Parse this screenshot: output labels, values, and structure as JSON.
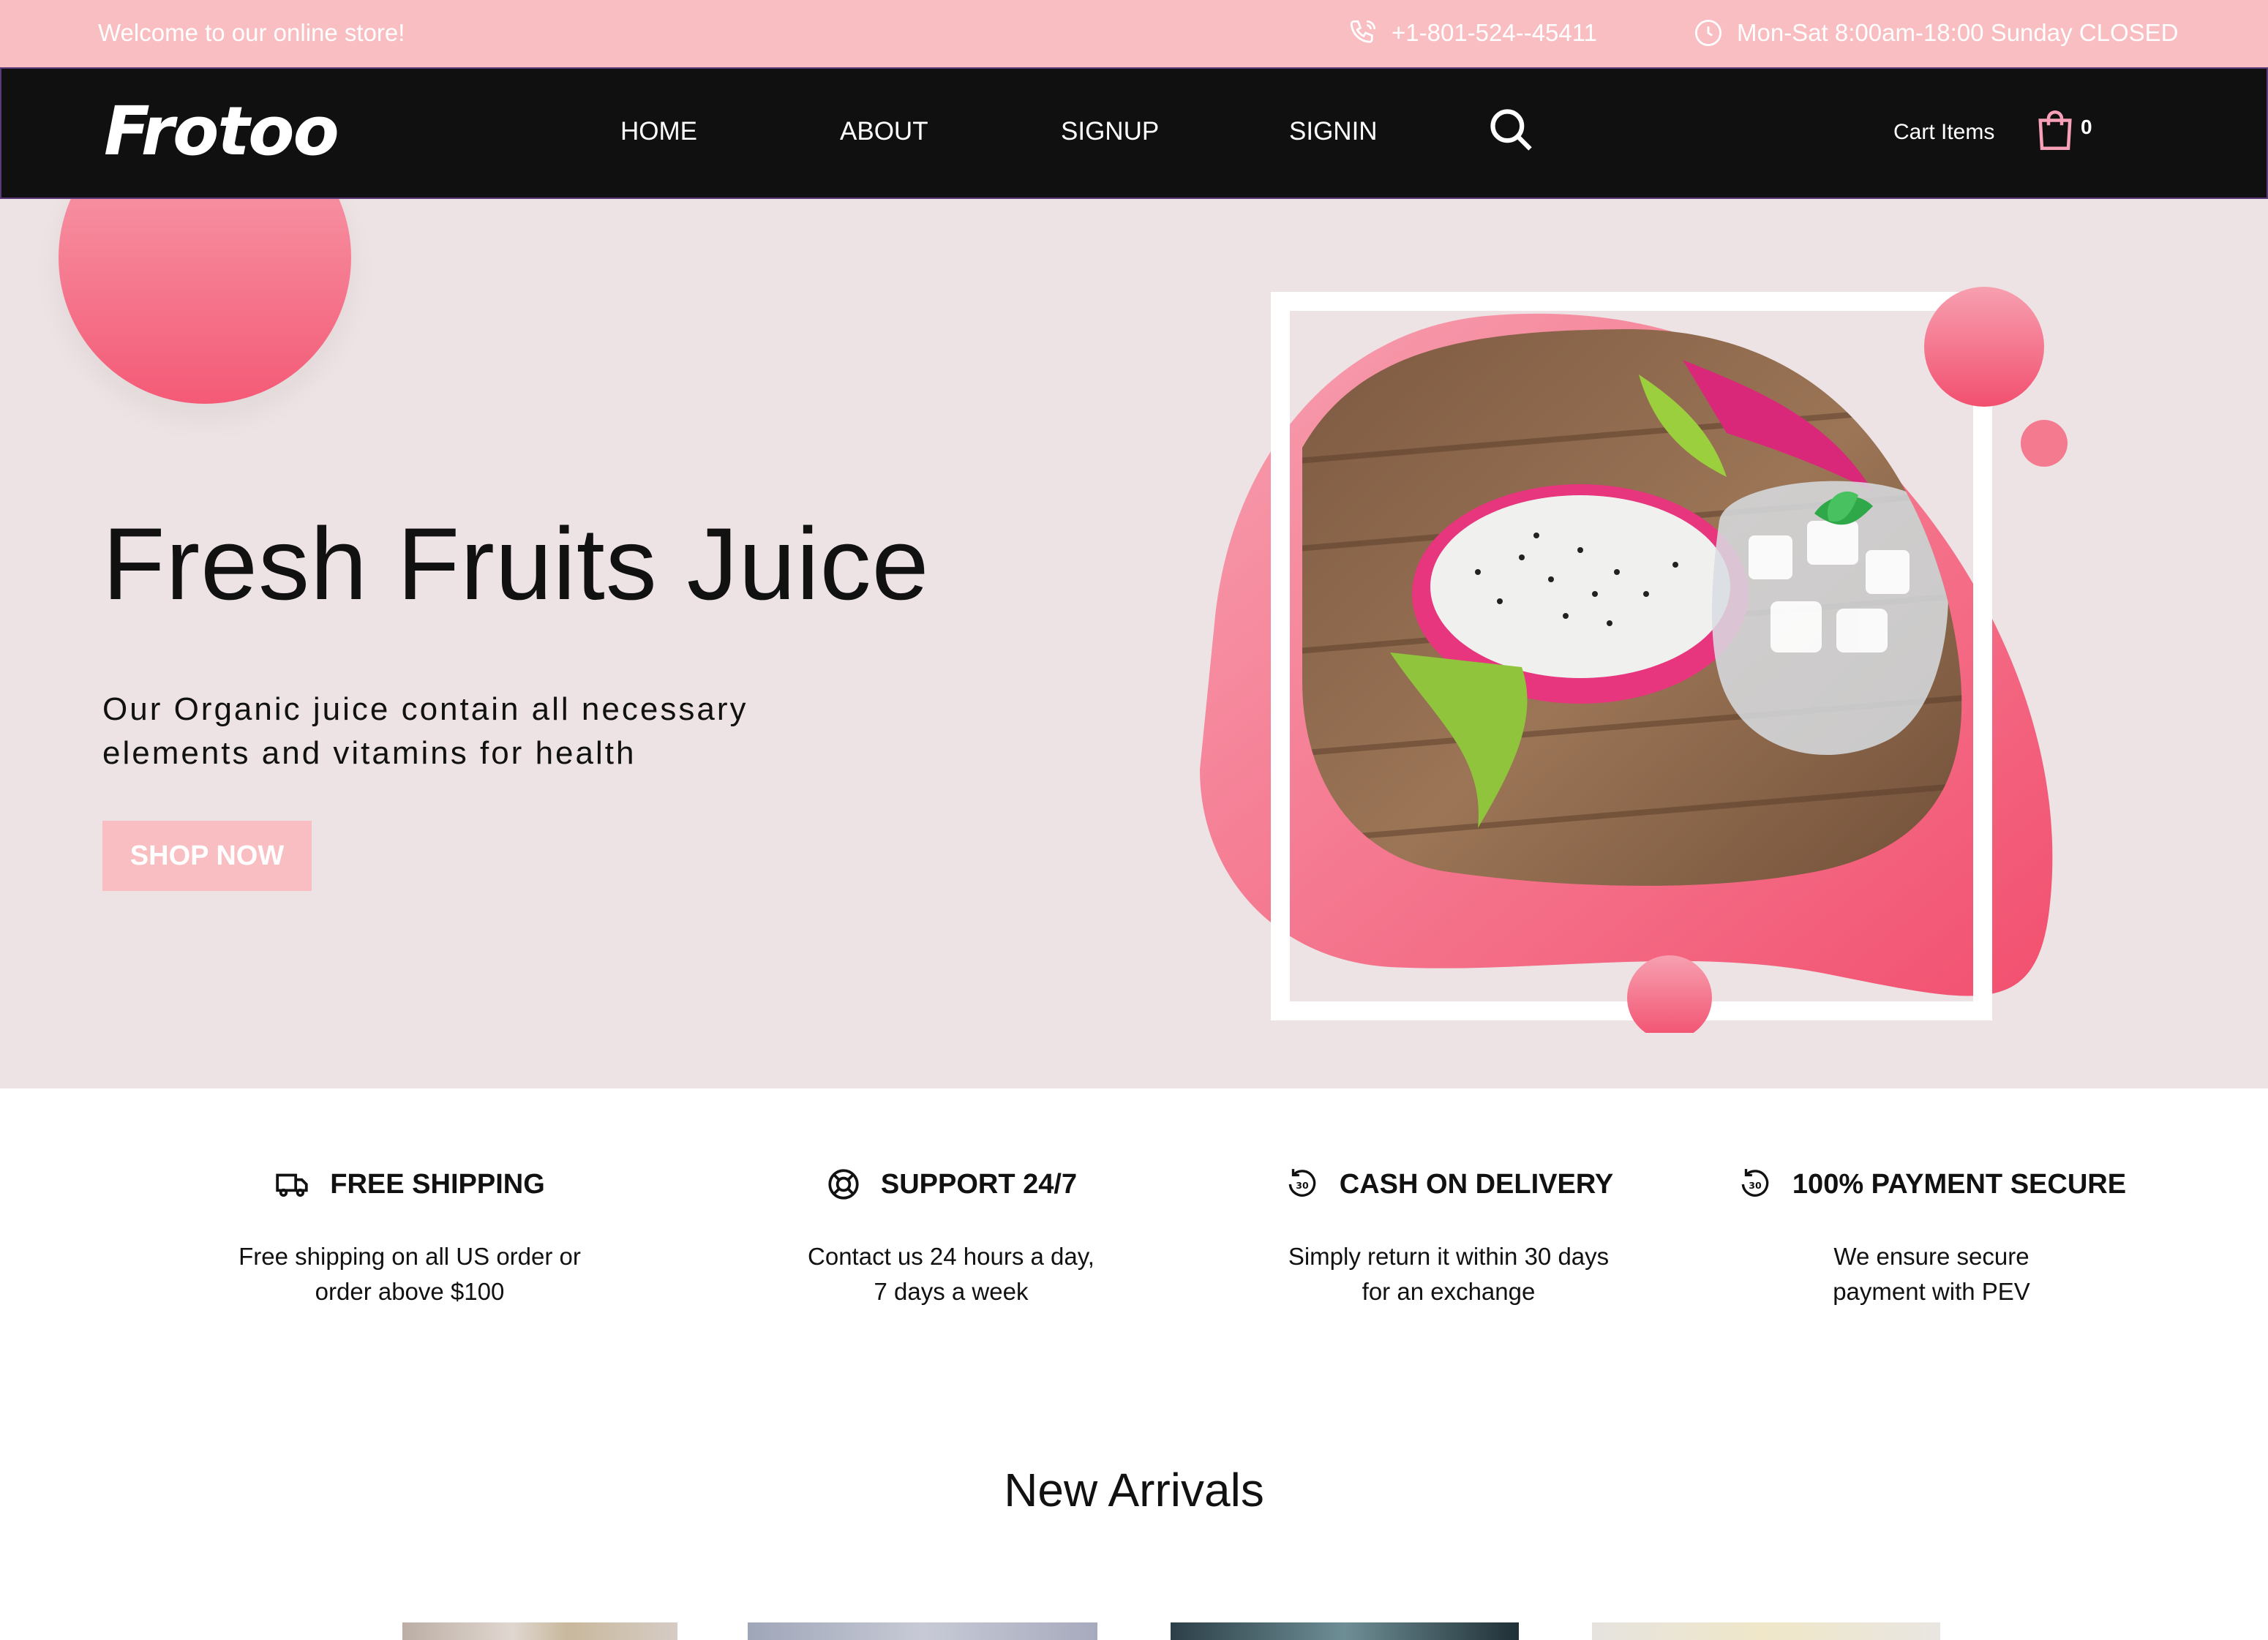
{
  "topbar": {
    "welcome": "Welcome to our online store!",
    "phone": "+1-801-524--45411",
    "hours": "Mon-Sat 8:00am-18:00 Sunday CLOSED",
    "phone_icon": "phone-icon",
    "clock_icon": "clock-icon"
  },
  "nav": {
    "logo": "Frotoo",
    "links": [
      "HOME",
      "ABOUT",
      "SIGNUP",
      "SIGNIN"
    ],
    "search_icon": "search-icon",
    "cart_label": "Cart Items",
    "cart_icon": "shopping-bag-icon",
    "cart_count": "0"
  },
  "hero": {
    "title": "Fresh Fruits Juice",
    "subtitle_line1": "Our Organic juice contain all necessary",
    "subtitle_line2": "elements and vitamins for health",
    "cta": "SHOP NOW"
  },
  "features": [
    {
      "icon": "truck-icon",
      "title": "FREE SHIPPING",
      "line1": "Free shipping on all US order or",
      "line2": "order above $100"
    },
    {
      "icon": "lifebuoy-icon",
      "title": "SUPPORT 24/7",
      "line1": "Contact us 24 hours a day,",
      "line2": "7 days a week"
    },
    {
      "icon": "return-30-icon",
      "title": "CASH ON DELIVERY",
      "line1": "Simply return it within 30 days",
      "line2": "for an exchange"
    },
    {
      "icon": "return-30-icon",
      "title": "100% PAYMENT SECURE",
      "line1": "We ensure secure",
      "line2": "payment with PEV"
    }
  ],
  "arrivals": {
    "title": "New Arrivals"
  },
  "colors": {
    "accent_pink": "#f8bec1",
    "blob_pink": "#f45a76",
    "nav_bg": "#101010",
    "hero_bg": "#ede3e4"
  }
}
